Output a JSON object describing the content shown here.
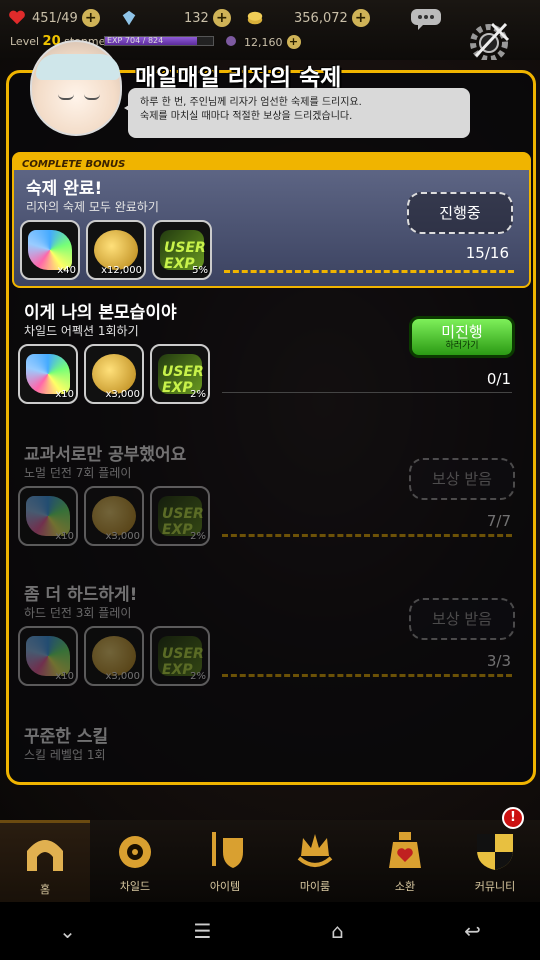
{
  "topbar": {
    "hearts": "451/49",
    "gems": "132",
    "gold": "356,072",
    "level_label": "Level",
    "level": "20",
    "player": "stonme",
    "exp_text": "EXP 704 / 824",
    "exp_fraction": 0.854,
    "sub_currency": "12,160",
    "chat_icon": "chat-bubble-icon",
    "settings_icon": "gear-icon"
  },
  "dialog": {
    "title": "매일매일 리자의 숙제",
    "speech_line1": "하루 한 번, 주인님께 리자가 엄선한 숙제를 드리지요.",
    "speech_line2": "숙제를 마치실 때마다 적절한 보상을 드리겠습니다.",
    "bonus_tab": "COMPLETE BONUS"
  },
  "quests": [
    {
      "title": "숙제 완료!",
      "desc": "리자의 숙제 모두 완료하기",
      "button": "진행중",
      "progress": "15/16",
      "rewards": [
        {
          "type": "gem",
          "qty": "x40"
        },
        {
          "type": "coin",
          "qty": "x12,000"
        },
        {
          "type": "exp",
          "label": "USER EXP",
          "qty": "5%"
        }
      ]
    },
    {
      "title": "이게 나의 본모습이야",
      "desc": "차일드 어펙션 1회하기",
      "button": "미진행",
      "button_sub": "하러가기",
      "progress": "0/1",
      "rewards": [
        {
          "type": "gem",
          "qty": "x10"
        },
        {
          "type": "coin",
          "qty": "x3,000"
        },
        {
          "type": "exp",
          "label": "USER EXP",
          "qty": "2%"
        }
      ]
    },
    {
      "title": "교과서로만 공부했어요",
      "desc": "노멀 던전 7회 플레이",
      "button": "보상 받음",
      "progress": "7/7",
      "rewards": [
        {
          "type": "gem",
          "qty": "x10"
        },
        {
          "type": "coin",
          "qty": "x3,000"
        },
        {
          "type": "exp",
          "label": "USER EXP",
          "qty": "2%"
        }
      ]
    },
    {
      "title": "좀 더 하드하게!",
      "desc": "하드 던전 3회 플레이",
      "button": "보상 받음",
      "progress": "3/3",
      "rewards": [
        {
          "type": "gem",
          "qty": "x10"
        },
        {
          "type": "coin",
          "qty": "x3,000"
        },
        {
          "type": "exp",
          "label": "USER EXP",
          "qty": "2%"
        }
      ]
    },
    {
      "title": "꾸준한 스킬",
      "desc": "스킬 레벨업 1회"
    }
  ],
  "nav": [
    {
      "label": "홈",
      "icon": "home-icon"
    },
    {
      "label": "차일드",
      "icon": "eye-flame-icon"
    },
    {
      "label": "아이템",
      "icon": "sword-shield-icon"
    },
    {
      "label": "마이룸",
      "icon": "crown-wreath-icon"
    },
    {
      "label": "소환",
      "icon": "potion-heart-icon"
    },
    {
      "label": "커뮤니티",
      "icon": "checker-shield-icon",
      "badge": "!"
    }
  ],
  "colors": {
    "accent": "#f0b400",
    "go_button": "#4fd52e",
    "panel_bg": "#08080a"
  }
}
